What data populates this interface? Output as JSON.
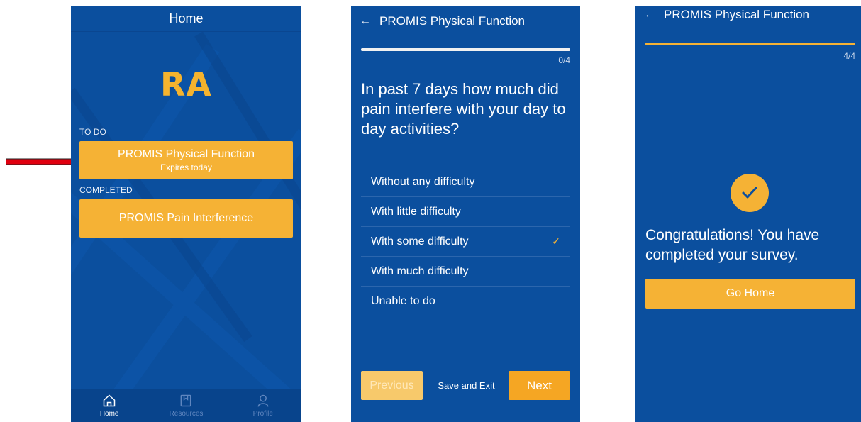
{
  "screen_home": {
    "title": "Home",
    "logo_text": "RA",
    "todo_label": "TO DO",
    "todo_task": {
      "title": "PROMIS Physical Function",
      "subtitle": "Expires today"
    },
    "completed_label": "COMPLETED",
    "completed_task": {
      "title": "PROMIS Pain Interference"
    },
    "nav": [
      {
        "label": "Home",
        "icon": "home-icon",
        "active": true
      },
      {
        "label": "Resources",
        "icon": "book-icon",
        "active": false
      },
      {
        "label": "Profile",
        "icon": "person-icon",
        "active": false
      }
    ]
  },
  "screen_question": {
    "back_icon": "arrow-left-icon",
    "title": "PROMIS Physical Function",
    "progress_text": "0/4",
    "progress_fraction": 0,
    "question": "In past 7 days how much did pain interfere with your day to day activities?",
    "options": [
      {
        "label": "Without any difficulty",
        "selected": false
      },
      {
        "label": "With little difficulty",
        "selected": false
      },
      {
        "label": "With some difficulty",
        "selected": true
      },
      {
        "label": "With much difficulty",
        "selected": false
      },
      {
        "label": "Unable to do",
        "selected": false
      }
    ],
    "selected_mark": "✓",
    "previous_label": "Previous",
    "save_exit_label": "Save and Exit",
    "next_label": "Next"
  },
  "screen_done": {
    "back_icon": "arrow-left-icon",
    "title": "PROMIS Physical Function",
    "progress_text": "4/4",
    "progress_fraction": 1,
    "message": "Congratulations! You have completed your survey.",
    "go_home_label": "Go Home"
  },
  "colors": {
    "background": "#0b4f9e",
    "accent": "#f5b235",
    "annotation_arrow": "#e0000f"
  }
}
